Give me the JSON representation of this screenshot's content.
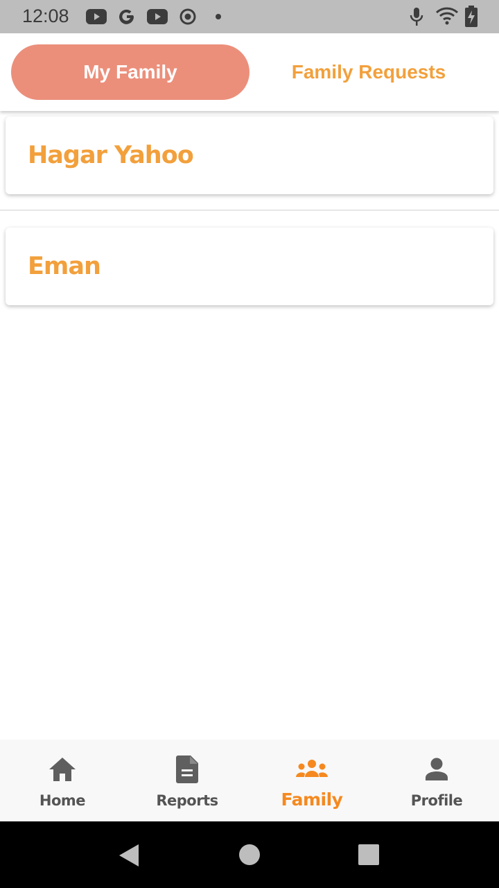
{
  "status_bar": {
    "time": "12:08",
    "left_icons": [
      "youtube-icon",
      "google-icon",
      "youtube-icon",
      "record-icon",
      "dot-icon"
    ],
    "right_icons": [
      "microphone-icon",
      "wifi-icon",
      "battery-charging-icon"
    ]
  },
  "tabs": [
    {
      "label": "My Family",
      "active": true
    },
    {
      "label": "Family Requests",
      "active": false
    }
  ],
  "family_members": [
    {
      "name": "Hagar Yahoo"
    },
    {
      "name": "Eman"
    }
  ],
  "bottom_nav": {
    "items": [
      {
        "label": "Home",
        "icon": "home-icon",
        "active": false
      },
      {
        "label": "Reports",
        "icon": "document-icon",
        "active": false
      },
      {
        "label": "Family",
        "icon": "group-icon",
        "active": true
      },
      {
        "label": "Profile",
        "icon": "person-icon",
        "active": false
      }
    ]
  },
  "colors": {
    "accent_orange": "#f2a03c",
    "active_tab_bg": "#eb8f7b",
    "nav_active": "#f5891f",
    "nav_inactive": "#545454"
  }
}
